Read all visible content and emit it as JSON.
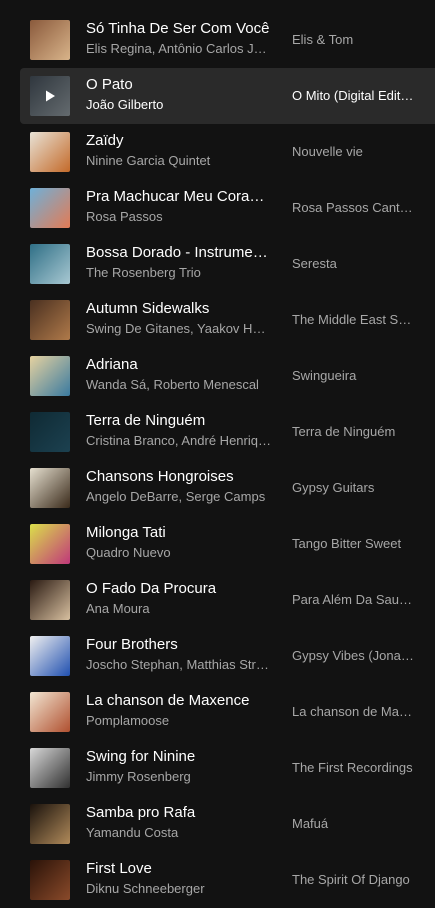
{
  "tracks": [
    {
      "title": "Só Tinha De Ser Com Você",
      "artist": "Elis Regina, Antônio Carlos Jobim",
      "album": "Elis & Tom",
      "cover_colors": [
        "#8a5a3c",
        "#d9b48a"
      ]
    },
    {
      "title": "O Pato",
      "artist": "João Gilberto",
      "album": "O Mito (Digital Edition)",
      "cover_colors": [
        "#4a5560",
        "#9aa4aa"
      ],
      "active": true
    },
    {
      "title": "Zaïdy",
      "artist": "Ninine Garcia Quintet",
      "album": "Nouvelle vie",
      "cover_colors": [
        "#e8e2d6",
        "#c46a2a"
      ]
    },
    {
      "title": "Pra Machucar Meu Coração",
      "artist": "Rosa Passos",
      "album": "Rosa Passos Canta Antonio Carlos Jobim",
      "cover_colors": [
        "#6fb0d8",
        "#e37b55"
      ]
    },
    {
      "title": "Bossa Dorado - Instrumental",
      "artist": "The Rosenberg Trio",
      "album": "Seresta",
      "cover_colors": [
        "#2f6f86",
        "#a8c8d2"
      ]
    },
    {
      "title": "Autumn Sidewalks",
      "artist": "Swing De Gitanes, Yaakov Hoter",
      "album": "The Middle East Swing",
      "cover_colors": [
        "#4a3020",
        "#b07a4a"
      ]
    },
    {
      "title": "Adriana",
      "artist": "Wanda Sá, Roberto Menescal",
      "album": "Swingueira",
      "cover_colors": [
        "#e6d2a0",
        "#3a7aa0"
      ]
    },
    {
      "title": "Terra de Ninguém",
      "artist": "Cristina Branco, André Henriques",
      "album": "Terra de Ninguém",
      "cover_colors": [
        "#0f2a34",
        "#1c4150"
      ]
    },
    {
      "title": "Chansons Hongroises",
      "artist": "Angelo DeBarre, Serge Camps",
      "album": "Gypsy Guitars",
      "cover_colors": [
        "#e6e0d0",
        "#3a2a1a"
      ]
    },
    {
      "title": "Milonga Tati",
      "artist": "Quadro Nuevo",
      "album": "Tango Bitter Sweet",
      "cover_colors": [
        "#dbe04a",
        "#c0387a"
      ]
    },
    {
      "title": "O Fado Da Procura",
      "artist": "Ana Moura",
      "album": "Para Além Da Saudade",
      "cover_colors": [
        "#2a1a12",
        "#d8c0a0"
      ]
    },
    {
      "title": "Four Brothers",
      "artist": "Joscho Stephan, Matthias Strucken",
      "album": "Gypsy Vibes (Jonathan)",
      "cover_colors": [
        "#f0f0f0",
        "#2050b0"
      ]
    },
    {
      "title": "La chanson de Maxence",
      "artist": "Pomplamoose",
      "album": "La chanson de Maxence",
      "cover_colors": [
        "#f2e6d2",
        "#b05030"
      ]
    },
    {
      "title": "Swing for Ninine",
      "artist": "Jimmy Rosenberg",
      "album": "The First Recordings",
      "cover_colors": [
        "#d8d8d8",
        "#303030"
      ]
    },
    {
      "title": "Samba pro Rafa",
      "artist": "Yamandu Costa",
      "album": "Mafuá",
      "cover_colors": [
        "#1a120c",
        "#b08a5a"
      ]
    },
    {
      "title": "First Love",
      "artist": "Diknu Schneeberger",
      "album": "The Spirit Of Django",
      "cover_colors": [
        "#2a1208",
        "#8a4a2a"
      ]
    }
  ]
}
